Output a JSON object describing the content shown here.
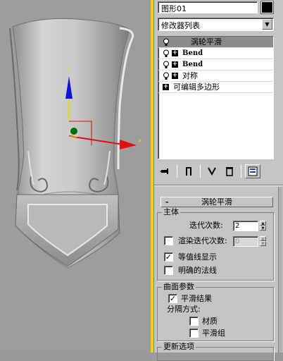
{
  "viewport": {
    "gizmo_colors": {
      "x": "#e01010",
      "y": "#1010e0",
      "z": "#e0e000",
      "center": "#007000",
      "border": "#f2d200"
    }
  },
  "panel": {
    "object_name": "图形01",
    "object_color": "#000000",
    "modifier_list_label": "修改器列表",
    "stack": [
      {
        "label": "涡轮平滑",
        "selected": true,
        "has_bulb": true,
        "has_plus": false
      },
      {
        "label": "Bend",
        "selected": false,
        "has_bulb": true,
        "has_plus": true
      },
      {
        "label": "Bend",
        "selected": false,
        "has_bulb": true,
        "has_plus": true
      },
      {
        "label": "对称",
        "selected": false,
        "has_bulb": true,
        "has_plus": true
      },
      {
        "label": "可编辑多边形",
        "selected": false,
        "has_bulb": false,
        "has_plus": true
      }
    ],
    "toolbar_icons": [
      "pin-stack-icon",
      "show-end-result-icon",
      "make-unique-icon",
      "remove-modifier-icon",
      "configure-modifier-sets-icon"
    ]
  },
  "rollout": {
    "minus": "-",
    "title": "涡轮平滑",
    "main_group": {
      "title": "主体",
      "iterations_label": "迭代次数:",
      "iterations_value": "2",
      "render_iters_label": "渲染迭代次数:",
      "render_iters_value": "0",
      "render_iters_checked": false,
      "isoline_label": "等值线显示",
      "isoline_checked": true,
      "explicit_normals_label": "明确的法线",
      "explicit_normals_checked": false
    },
    "surface_group": {
      "title": "曲面参数",
      "smooth_result_label": "平滑结果",
      "smooth_result_checked": true,
      "separate_by_label": "分隔方式:",
      "materials_label": "材质",
      "materials_checked": false,
      "smoothing_groups_label": "平滑组",
      "smoothing_groups_checked": false
    },
    "update_group": {
      "title": "更新选项"
    }
  }
}
